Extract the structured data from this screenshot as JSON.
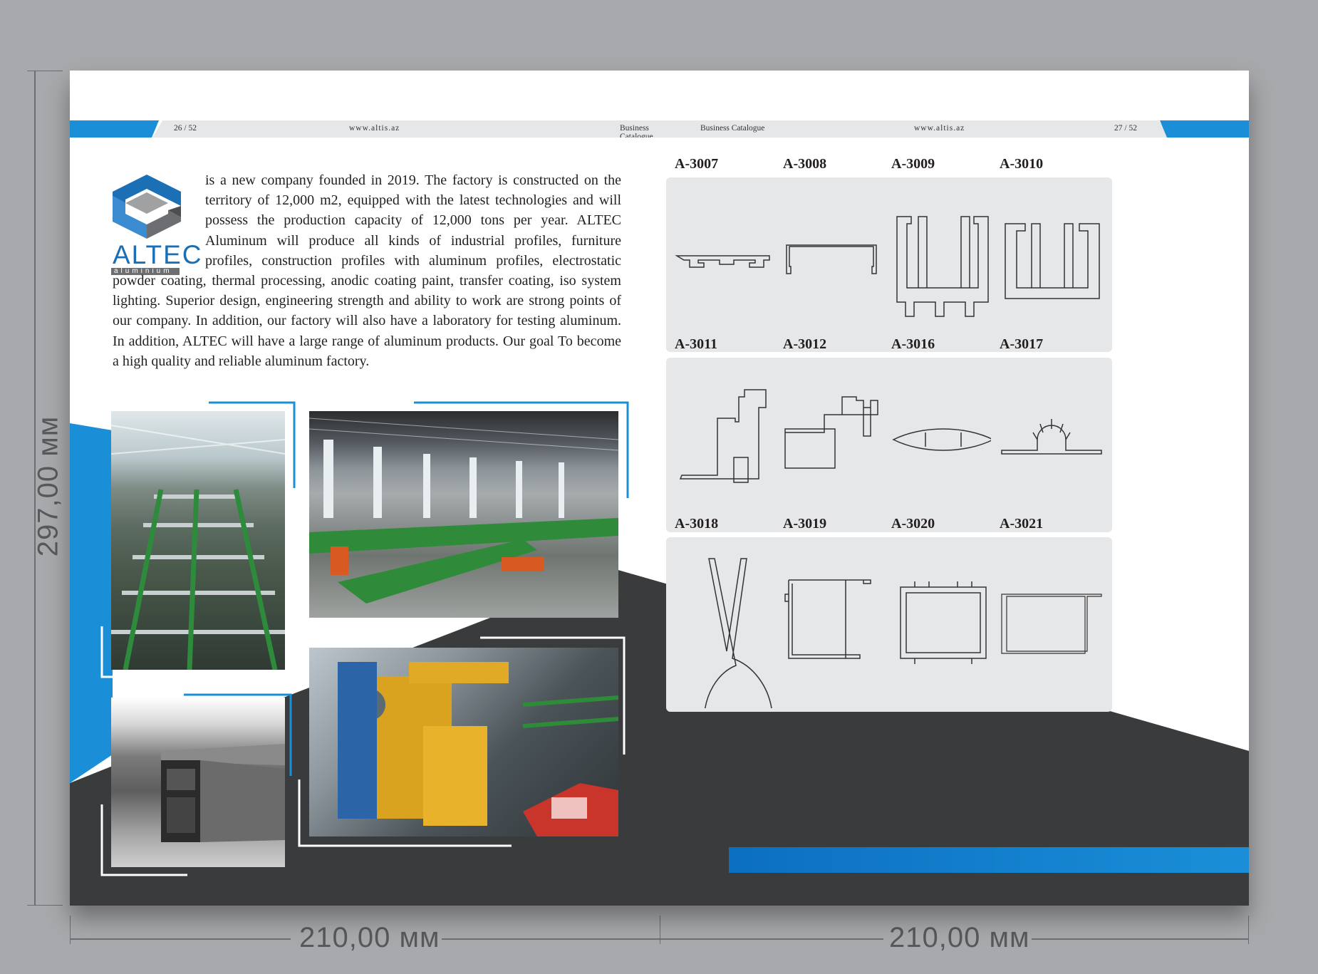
{
  "dimensions": {
    "height_label": "297,00 мм",
    "left_width_label": "210,00 мм",
    "right_width_label": "210,00 мм"
  },
  "header": {
    "left_page": "26 / 52",
    "left_site": "www.altis.az",
    "left_title": "Business Catalogue",
    "right_title": "Business Catalogue",
    "right_site": "www.altis.az",
    "right_page": "27 / 52"
  },
  "logo": {
    "name": "ALTEC",
    "sub": "aluminium"
  },
  "intro": {
    "text": "is a new company founded in 2019. The factory is constructed on the territory of 12,000 m2, equipped with the latest technologies and will possess the production capacity of 12,000 tons per year. ALTEC Aluminum will produce all kinds of industrial profiles, furniture profiles, construction profiles with aluminum profiles, electrostatic powder coating, thermal processing, anodic coating paint, transfer coating, iso system lighting. Superior design, engineering strength and ability to work are strong points of our company. In addition, our factory will also have a laboratory for testing aluminum. In addition, ALTEC will have a large range of aluminum products.  Our goal To become a high quality and reliable aluminum factory."
  },
  "photos": [
    {
      "name": "roller-conveyor-photo"
    },
    {
      "name": "factory-hall-photo"
    },
    {
      "name": "profile-closeup-photo"
    },
    {
      "name": "cutting-machine-photo"
    }
  ],
  "profiles": [
    {
      "code": "A-3007",
      "icon": "flat-rail-profile"
    },
    {
      "code": "A-3008",
      "icon": "channel-profile"
    },
    {
      "code": "A-3009",
      "icon": "double-slot-profile"
    },
    {
      "code": "A-3010",
      "icon": "double-c-profile"
    },
    {
      "code": "A-3011",
      "icon": "frame-profile"
    },
    {
      "code": "A-3012",
      "icon": "stepped-frame-profile"
    },
    {
      "code": "A-3016",
      "icon": "oval-profile"
    },
    {
      "code": "A-3017",
      "icon": "heatsink-profile"
    },
    {
      "code": "A-3018",
      "icon": "tong-profile"
    },
    {
      "code": "A-3019",
      "icon": "box-frame-profile"
    },
    {
      "code": "A-3020",
      "icon": "rect-sash-profile"
    },
    {
      "code": "A-3021",
      "icon": "thin-frame-profile"
    }
  ],
  "colors": {
    "accent_blue": "#1a8fd8",
    "dark": "#3a3b3d",
    "card": "#e6e7e8"
  }
}
